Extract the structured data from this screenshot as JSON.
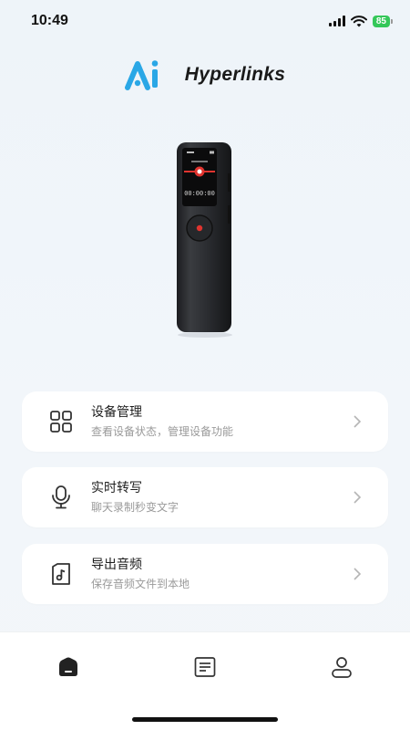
{
  "status_bar": {
    "time": "10:49",
    "battery": "85"
  },
  "brand": {
    "logo_text": "Hyperlinks",
    "accent_color": "#2aa7e6"
  },
  "device": {
    "screen_time": "00:00:00"
  },
  "menu": [
    {
      "title": "设备管理",
      "subtitle": "查看设备状态，管理设备功能",
      "icon": "grid-icon"
    },
    {
      "title": "实时转写",
      "subtitle": "聊天录制秒变文字",
      "icon": "microphone-icon"
    },
    {
      "title": "导出音频",
      "subtitle": "保存音频文件到本地",
      "icon": "music-file-icon"
    }
  ],
  "tabbar": {
    "tabs": [
      "home-icon",
      "list-icon",
      "profile-icon"
    ]
  }
}
